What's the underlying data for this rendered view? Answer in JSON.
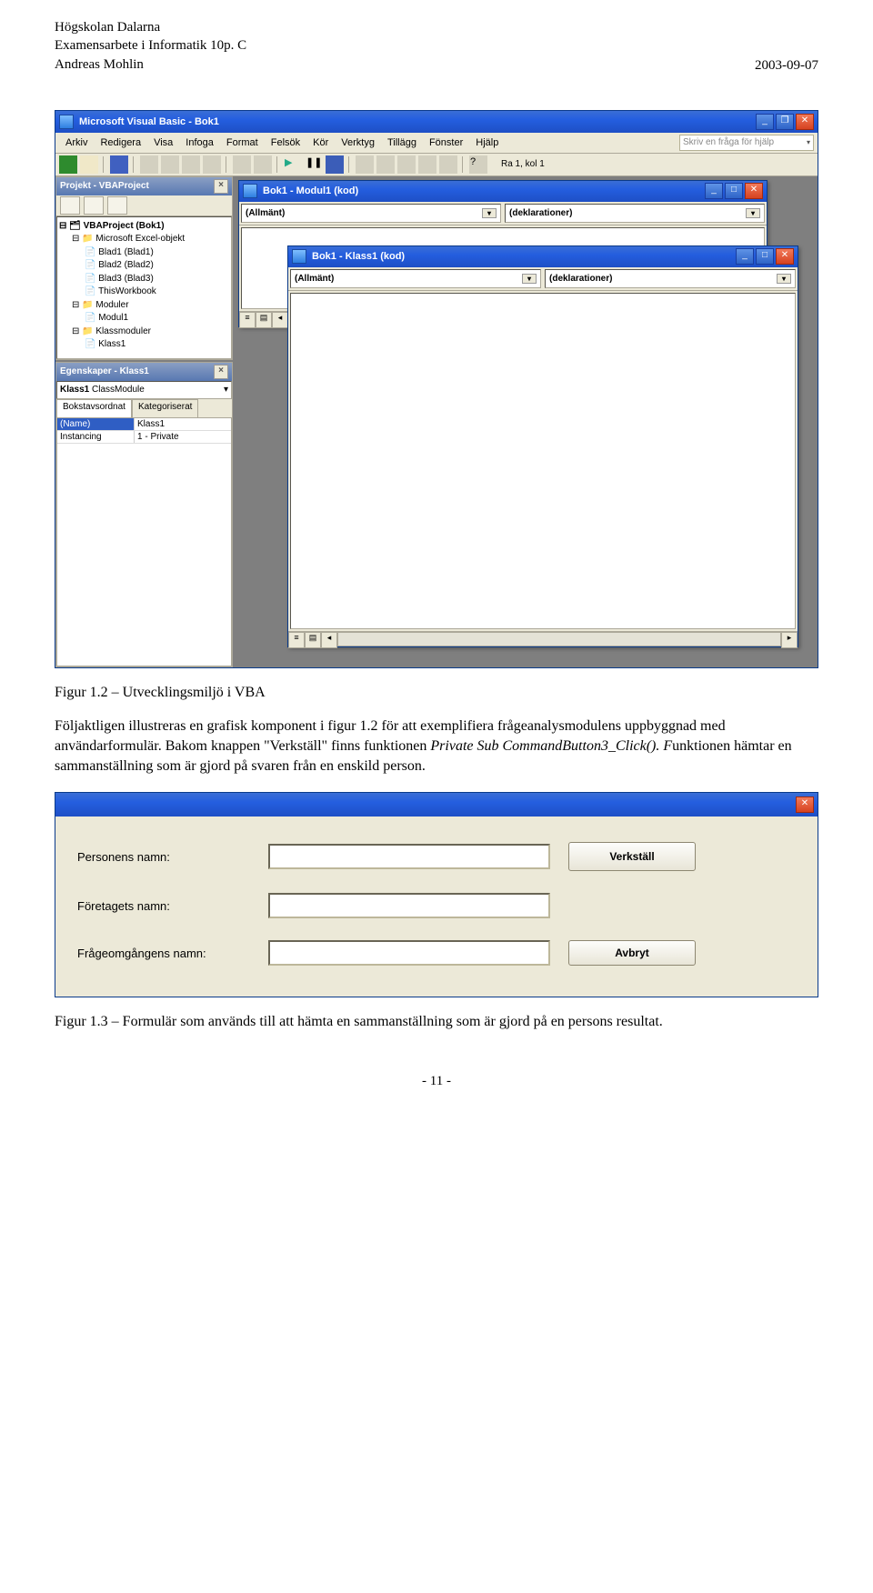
{
  "header": {
    "org": "Högskolan Dalarna",
    "course": "Examensarbete i Informatik 10p. C",
    "author": "Andreas Mohlin",
    "date": "2003-09-07"
  },
  "vba": {
    "title": "Microsoft Visual Basic - Bok1",
    "menus": [
      "Arkiv",
      "Redigera",
      "Visa",
      "Infoga",
      "Format",
      "Felsök",
      "Kör",
      "Verktyg",
      "Tillägg",
      "Fönster",
      "Hjälp"
    ],
    "help_placeholder": "Skriv en fråga för hjälp",
    "cursor_pos": "Ra 1, kol 1",
    "project_pane_title": "Projekt - VBAProject",
    "tree": {
      "root": "VBAProject (Bok1)",
      "excel_group": "Microsoft Excel-objekt",
      "blad1": "Blad1 (Blad1)",
      "blad2": "Blad2 (Blad2)",
      "blad3": "Blad3 (Blad3)",
      "thiswb": "ThisWorkbook",
      "moduler": "Moduler",
      "modul1": "Modul1",
      "klassmoduler": "Klassmoduler",
      "klass1": "Klass1"
    },
    "props_pane_title": "Egenskaper - Klass1",
    "props_select": "Klass1 ClassModule",
    "tab_alpha": "Bokstavsordnat",
    "tab_cat": "Kategoriserat",
    "prop_name_k": "(Name)",
    "prop_name_v": "Klass1",
    "prop_inst_k": "Instancing",
    "prop_inst_v": "1 - Private",
    "child_modul_title": "Bok1 - Modul1 (kod)",
    "child_klass_title": "Bok1 - Klass1 (kod)",
    "dd_general": "(Allmänt)",
    "dd_decl": "(deklarationer)"
  },
  "caption1": "Figur 1.2 – Utvecklingsmiljö i VBA",
  "para1_a": "Följaktligen illustreras en grafisk komponent i figur 1.2 för att exemplifiera frågeanalysmodulens uppbyggnad med användarformulär. Bakom knappen \"Verkställ\" finns funktionen ",
  "para1_ital": "Private Sub CommandButton3_Click(). F",
  "para1_b": "unktionen hämtar en sammanställning som är gjord på svaren från en enskild person.",
  "form": {
    "label_person": "Personens namn:",
    "label_company": "Företagets namn:",
    "label_round": "Frågeomgångens namn:",
    "btn_exec": "Verkställ",
    "btn_cancel": "Avbryt"
  },
  "caption2": "Figur 1.3 – Formulär som används till att hämta en sammanställning som är gjord på en persons resultat.",
  "page_num": "- 11 -"
}
